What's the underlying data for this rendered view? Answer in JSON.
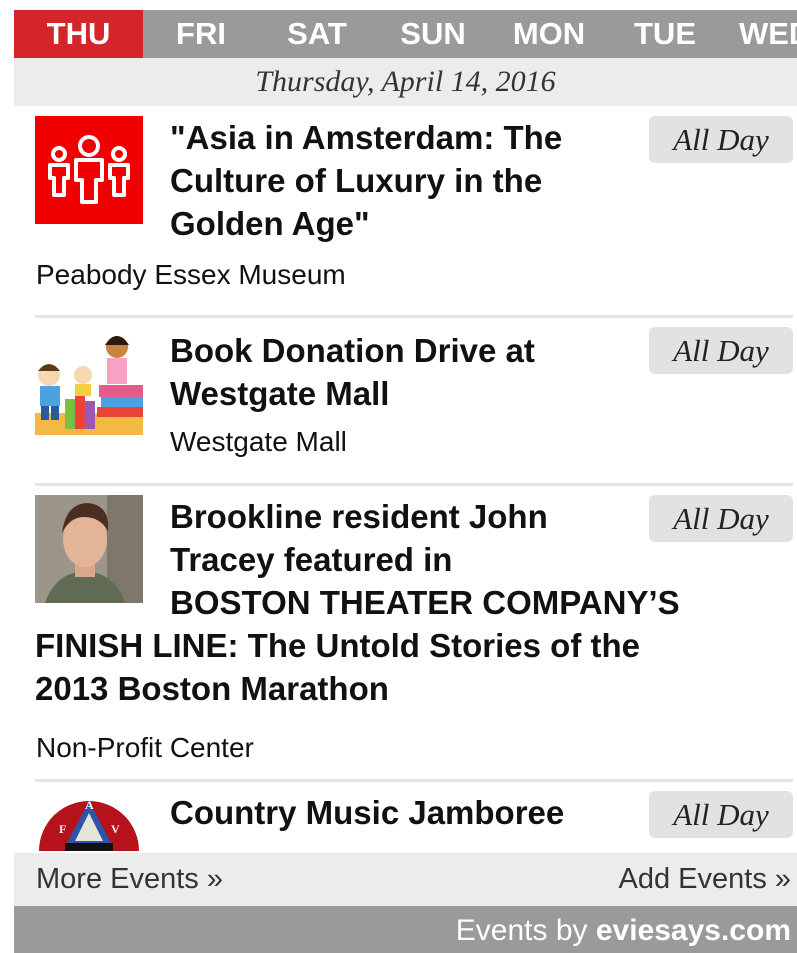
{
  "day_tabs": [
    {
      "label": "THU",
      "active": true
    },
    {
      "label": "FRI",
      "active": false
    },
    {
      "label": "SAT",
      "active": false
    },
    {
      "label": "SUN",
      "active": false
    },
    {
      "label": "MON",
      "active": false
    },
    {
      "label": "TUE",
      "active": false
    },
    {
      "label": "WED",
      "active": false
    }
  ],
  "date_header": "Thursday, April 14, 2016",
  "events": [
    {
      "title": "\"Asia in Amsterdam: The Culture of Luxury in the Golden Age\"",
      "time": "All Day",
      "venue": "Peabody Essex Museum",
      "thumb_icon": "family-icon"
    },
    {
      "title": "Book Donation Drive at Westgate Mall",
      "time": "All Day",
      "venue": "Westgate Mall",
      "thumb_icon": "kids-reading-illustration"
    },
    {
      "title_lines_beside": [
        "Brookline resident John",
        "Tracey featured in",
        "BOSTON THEATER COMPANY’S"
      ],
      "title_lines_full": [
        "FINISH LINE: The Untold Stories of the",
        "2013 Boston Marathon"
      ],
      "time": "All Day",
      "venue": "Non-Profit Center",
      "thumb_icon": "portrait-photo"
    },
    {
      "title": "Country Music Jamboree",
      "time": "All Day",
      "thumb_icon": "fav-emblem-logo",
      "emblem_letters": [
        "F",
        "A",
        "V"
      ]
    }
  ],
  "footer": {
    "more_events": "More Events »",
    "add_events": "Add Events »",
    "brand_prefix": "Events by ",
    "brand_name": "eviesays.com"
  },
  "colors": {
    "active_tab": "#d4252b",
    "tab_bar": "#9a9a9a",
    "header_bg": "#ececec",
    "badge_bg": "#e2e2e2"
  }
}
